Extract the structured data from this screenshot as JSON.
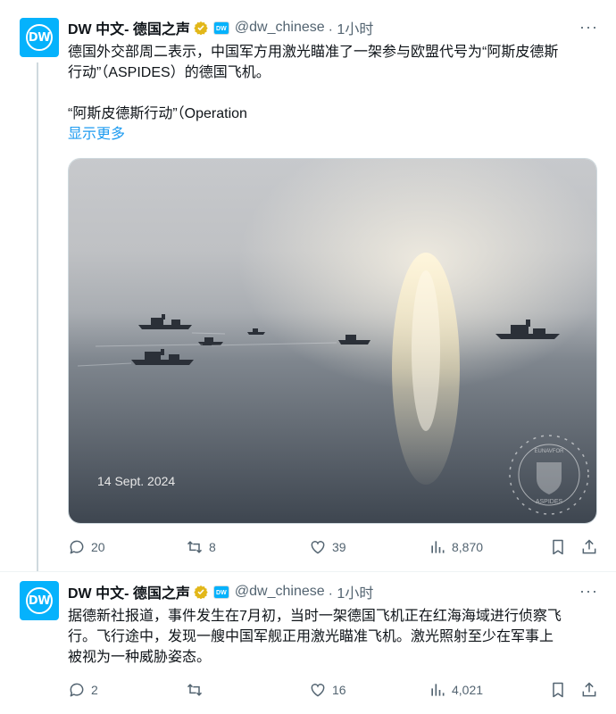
{
  "tweets": [
    {
      "author_name": "DW 中文- 德国之声",
      "handle": "@dw_chinese",
      "time": "· 1小时",
      "avatar_text": "DW",
      "affiliate_badge": "DW",
      "text_lines": [
        "德国外交部周二表示，中国军方用激光瞄准了一架参与欧盟代号为“阿斯皮德斯",
        "行动”（ASPIDES）的德国飞机。",
        "",
        "“阿斯皮德斯行动”（Operation"
      ],
      "show_more": "显示更多",
      "image": {
        "date_caption": "14 Sept. 2024",
        "emblem_text": "ASPIDES",
        "emblem_top_text": "EUNAVFOR"
      },
      "stats": {
        "replies": "20",
        "retweets": "8",
        "likes": "39",
        "views": "8,870"
      }
    },
    {
      "author_name": "DW 中文- 德国之声",
      "handle": "@dw_chinese",
      "time": "· 1小时",
      "avatar_text": "DW",
      "affiliate_badge": "DW",
      "text_lines": [
        "据德新社报道，事件发生在7月初，当时一架德国飞机正在红海海域进行侦察飞",
        "行。飞行途中，发现一艘中国军舰正用激光瞄准飞机。激光照射至少在军事上",
        "被视为一种威胁姿态。"
      ],
      "stats": {
        "replies": "2",
        "retweets": "",
        "likes": "16",
        "views": "4,021"
      }
    }
  ],
  "icons": [
    "more-icon",
    "verified-badge-icon",
    "reply-icon",
    "retweet-icon",
    "like-icon",
    "views-icon",
    "bookmark-icon",
    "share-icon"
  ],
  "colors": {
    "accent": "#1d9bf0",
    "dw_blue": "#05b2fc",
    "muted": "#536471",
    "gold_badge": "#e2b719"
  }
}
